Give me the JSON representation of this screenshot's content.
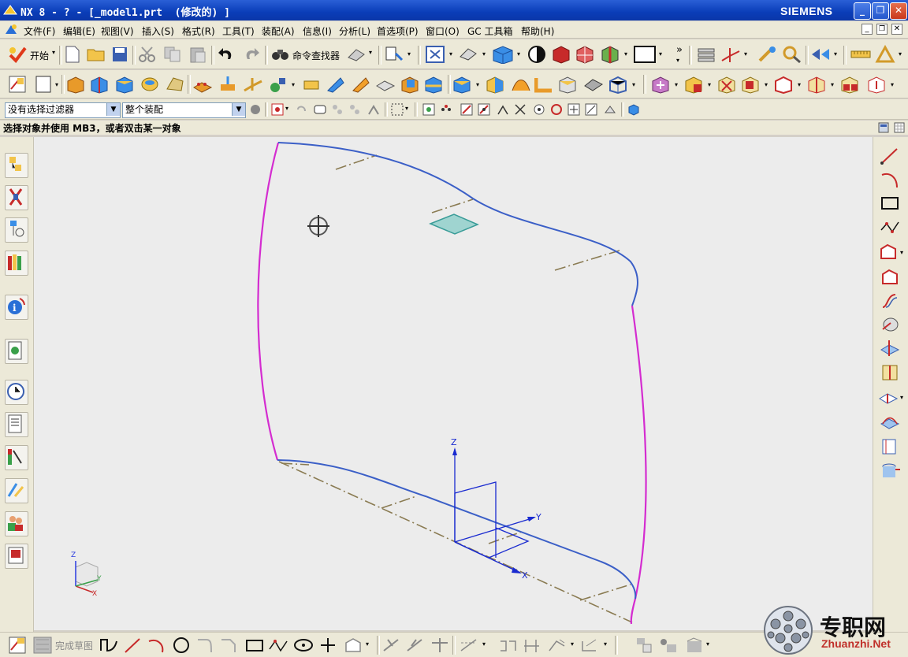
{
  "window": {
    "title": "NX 8 - ? - [_model1.prt  (修改的) ]",
    "brand": "SIEMENS",
    "minimize": "_",
    "restore": "❐",
    "close": "✕"
  },
  "menubar": {
    "items": [
      "文件(F)",
      "编辑(E)",
      "视图(V)",
      "插入(S)",
      "格式(R)",
      "工具(T)",
      "装配(A)",
      "信息(I)",
      "分析(L)",
      "首选项(P)",
      "窗口(O)",
      "GC 工具箱",
      "帮助(H)"
    ]
  },
  "toolbar_standard": {
    "start_label": "开始",
    "command_finder_label": "命令查找器"
  },
  "selection_bar": {
    "filter_value": "没有选择过滤器",
    "scope_value": "整个装配"
  },
  "cue_line": "选择对象并使用 MB3，或者双击某一对象",
  "sketch_bar": {
    "finish_sketch_label": "完成草图"
  },
  "viewport": {
    "axis_labels": {
      "z": "Z",
      "y": "Y",
      "x": "X"
    },
    "triad_labels": {
      "z": "Z",
      "y": "Y",
      "x": "X"
    }
  },
  "watermark": {
    "brand_cn": "专职网",
    "brand_url": "Zhuanzhi.Net"
  },
  "colors": {
    "titlebar": "#0a3db8",
    "curve_blue": "#3b5fc7",
    "curve_magenta": "#d42cd0",
    "centerline": "#8a7b52",
    "plane_fill": "#9fd4d0",
    "csys_blue": "#1a2bd0"
  }
}
